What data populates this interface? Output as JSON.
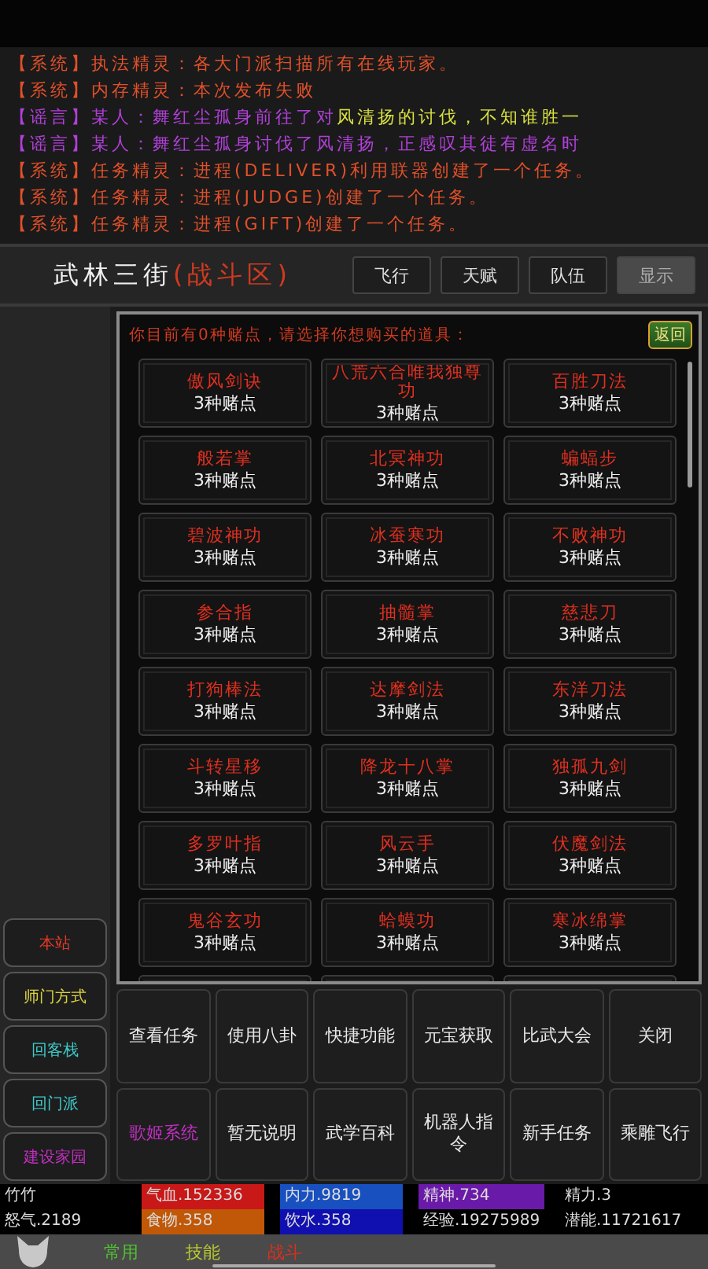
{
  "log": [
    {
      "kind": "system",
      "channel": "【系统】",
      "text": "执法精灵：各大门派扫描所有在线玩家。"
    },
    {
      "kind": "system",
      "channel": "【系统】",
      "text": "内存精灵：本次发布失败"
    },
    {
      "kind": "rumor",
      "channel": "【谣言】",
      "text": "某人：舞红尘孤身前往了对",
      "highlight": "风清扬的讨伐，不知谁胜一"
    },
    {
      "kind": "rumor",
      "channel": "【谣言】",
      "text": "某人：舞红尘孤身讨伐了风清扬，正感叹其徒有虚名时"
    },
    {
      "kind": "system",
      "channel": "【系统】",
      "text": "任务精灵：进程(DELIVER)利用联器创建了一个任务。"
    },
    {
      "kind": "system",
      "channel": "【系统】",
      "text": "任务精灵：进程(JUDGE)创建了一个任务。"
    },
    {
      "kind": "system",
      "channel": "【系统】",
      "text": "任务精灵：进程(GIFT)创建了一个任务。"
    }
  ],
  "location": {
    "name": "武林三街",
    "zone": "(战斗区)"
  },
  "header_buttons": [
    {
      "label": "飞行",
      "selected": false
    },
    {
      "label": "天赋",
      "selected": false
    },
    {
      "label": "队伍",
      "selected": false
    },
    {
      "label": "显示",
      "selected": true
    }
  ],
  "shop": {
    "prompt": "你目前有0种赌点，请选择你想购买的道具：",
    "back": "返回",
    "items": [
      {
        "name": "傲风剑诀",
        "cost": "3种赌点"
      },
      {
        "name": "八荒六合唯我独尊功",
        "cost": "3种赌点"
      },
      {
        "name": "百胜刀法",
        "cost": "3种赌点"
      },
      {
        "name": "般若掌",
        "cost": "3种赌点"
      },
      {
        "name": "北冥神功",
        "cost": "3种赌点"
      },
      {
        "name": "蝙蝠步",
        "cost": "3种赌点"
      },
      {
        "name": "碧波神功",
        "cost": "3种赌点"
      },
      {
        "name": "冰蚕寒功",
        "cost": "3种赌点"
      },
      {
        "name": "不败神功",
        "cost": "3种赌点"
      },
      {
        "name": "参合指",
        "cost": "3种赌点"
      },
      {
        "name": "抽髓掌",
        "cost": "3种赌点"
      },
      {
        "name": "慈悲刀",
        "cost": "3种赌点"
      },
      {
        "name": "打狗棒法",
        "cost": "3种赌点"
      },
      {
        "name": "达摩剑法",
        "cost": "3种赌点"
      },
      {
        "name": "东洋刀法",
        "cost": "3种赌点"
      },
      {
        "name": "斗转星移",
        "cost": "3种赌点"
      },
      {
        "name": "降龙十八掌",
        "cost": "3种赌点"
      },
      {
        "name": "独孤九剑",
        "cost": "3种赌点"
      },
      {
        "name": "多罗叶指",
        "cost": "3种赌点"
      },
      {
        "name": "风云手",
        "cost": "3种赌点"
      },
      {
        "name": "伏魔剑法",
        "cost": "3种赌点"
      },
      {
        "name": "鬼谷玄功",
        "cost": "3种赌点"
      },
      {
        "name": "蛤蟆功",
        "cost": "3种赌点"
      },
      {
        "name": "寒冰绵掌",
        "cost": "3种赌点"
      }
    ]
  },
  "sidebar": [
    {
      "label": "本站",
      "color": "#e03a2a"
    },
    {
      "label": "师门方式",
      "color": "#d8d040"
    },
    {
      "label": "回客栈",
      "color": "#40c8c8"
    },
    {
      "label": "回门派",
      "color": "#40c8c8"
    },
    {
      "label": "建设家园",
      "color": "#c030c0"
    }
  ],
  "actions": [
    {
      "label": "查看任务",
      "color": "#e8e8e8"
    },
    {
      "label": "使用八卦",
      "color": "#e8e8e8"
    },
    {
      "label": "快捷功能",
      "color": "#e8e8e8"
    },
    {
      "label": "元宝获取",
      "color": "#e8e8e8"
    },
    {
      "label": "比武大会",
      "color": "#e8e8e8"
    },
    {
      "label": "关闭",
      "color": "#e8e8e8"
    },
    {
      "label": "歌姬系统",
      "color": "#c030c0"
    },
    {
      "label": "暂无说明",
      "color": "#e8e8e8"
    },
    {
      "label": "武学百科",
      "color": "#e8e8e8"
    },
    {
      "label": "机器人指令",
      "color": "#e8e8e8"
    },
    {
      "label": "新手任务",
      "color": "#e8e8e8"
    },
    {
      "label": "乘雕飞行",
      "color": "#e8e8e8"
    }
  ],
  "stats": [
    {
      "name": "竹竹",
      "color": "#000000"
    },
    {
      "name": "气血.152336",
      "color": "#c81818"
    },
    {
      "name": "内力.9819",
      "color": "#1850c0"
    },
    {
      "name": "精神.734",
      "color": "#6a1aa8"
    },
    {
      "name": "精力.3",
      "color": "#000000"
    },
    {
      "name": "怒气.2189",
      "color": "#000000"
    },
    {
      "name": "食物.358",
      "color": "#c05808"
    },
    {
      "name": "饮水.358",
      "color": "#1010b0"
    },
    {
      "name": "经验.19275989",
      "color": "#000000"
    },
    {
      "name": "潜能.11721617",
      "color": "#000000"
    }
  ],
  "bottom_tabs": [
    {
      "label": "常用",
      "color": "#50c030"
    },
    {
      "label": "技能",
      "color": "#b8c830"
    },
    {
      "label": "战斗",
      "color": "#d83020"
    }
  ]
}
